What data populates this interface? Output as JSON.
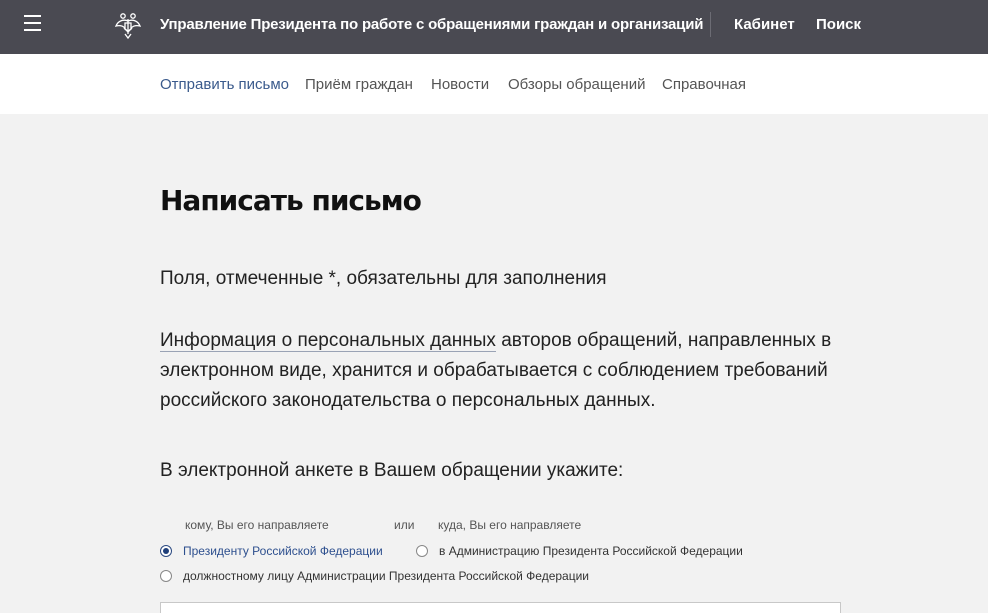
{
  "header": {
    "site_title": "Управление Президента по работе с обращениями граждан и организаций",
    "cabinet_link": "Кабинет",
    "search_link": "Поиск"
  },
  "subnav": {
    "items": [
      "Отправить письмо",
      "Приём граждан",
      "Новости",
      "Обзоры обращений",
      "Справочная"
    ]
  },
  "main": {
    "title": "Написать письмо",
    "required_note": "Поля, отмеченные *, обязательны для заполнения",
    "privacy": {
      "link_text": "Информация о персональных данных",
      "rest": " авторов обращений, направленных в электронном виде, хранится и обрабатывается с соблюдением требований российского законодательства о персональных данных."
    },
    "instruction": "В электронной анкете в Вашем обращении укажите:",
    "recipient": {
      "hint_whom": "кому, Вы его направляете",
      "hint_or": "или",
      "hint_where": "куда, Вы его направляете",
      "options": [
        {
          "label": "Президенту Российской Федерации",
          "checked": true
        },
        {
          "label": "в Администрацию Президента Российской Федерации",
          "checked": false
        },
        {
          "label": "должностному лицу Администрации Президента Российской Федерации",
          "checked": false
        }
      ]
    }
  },
  "colors": {
    "header_bg": "#4a4a52",
    "accent": "#3a5a8c",
    "page_bg": "#f2f2f2"
  }
}
